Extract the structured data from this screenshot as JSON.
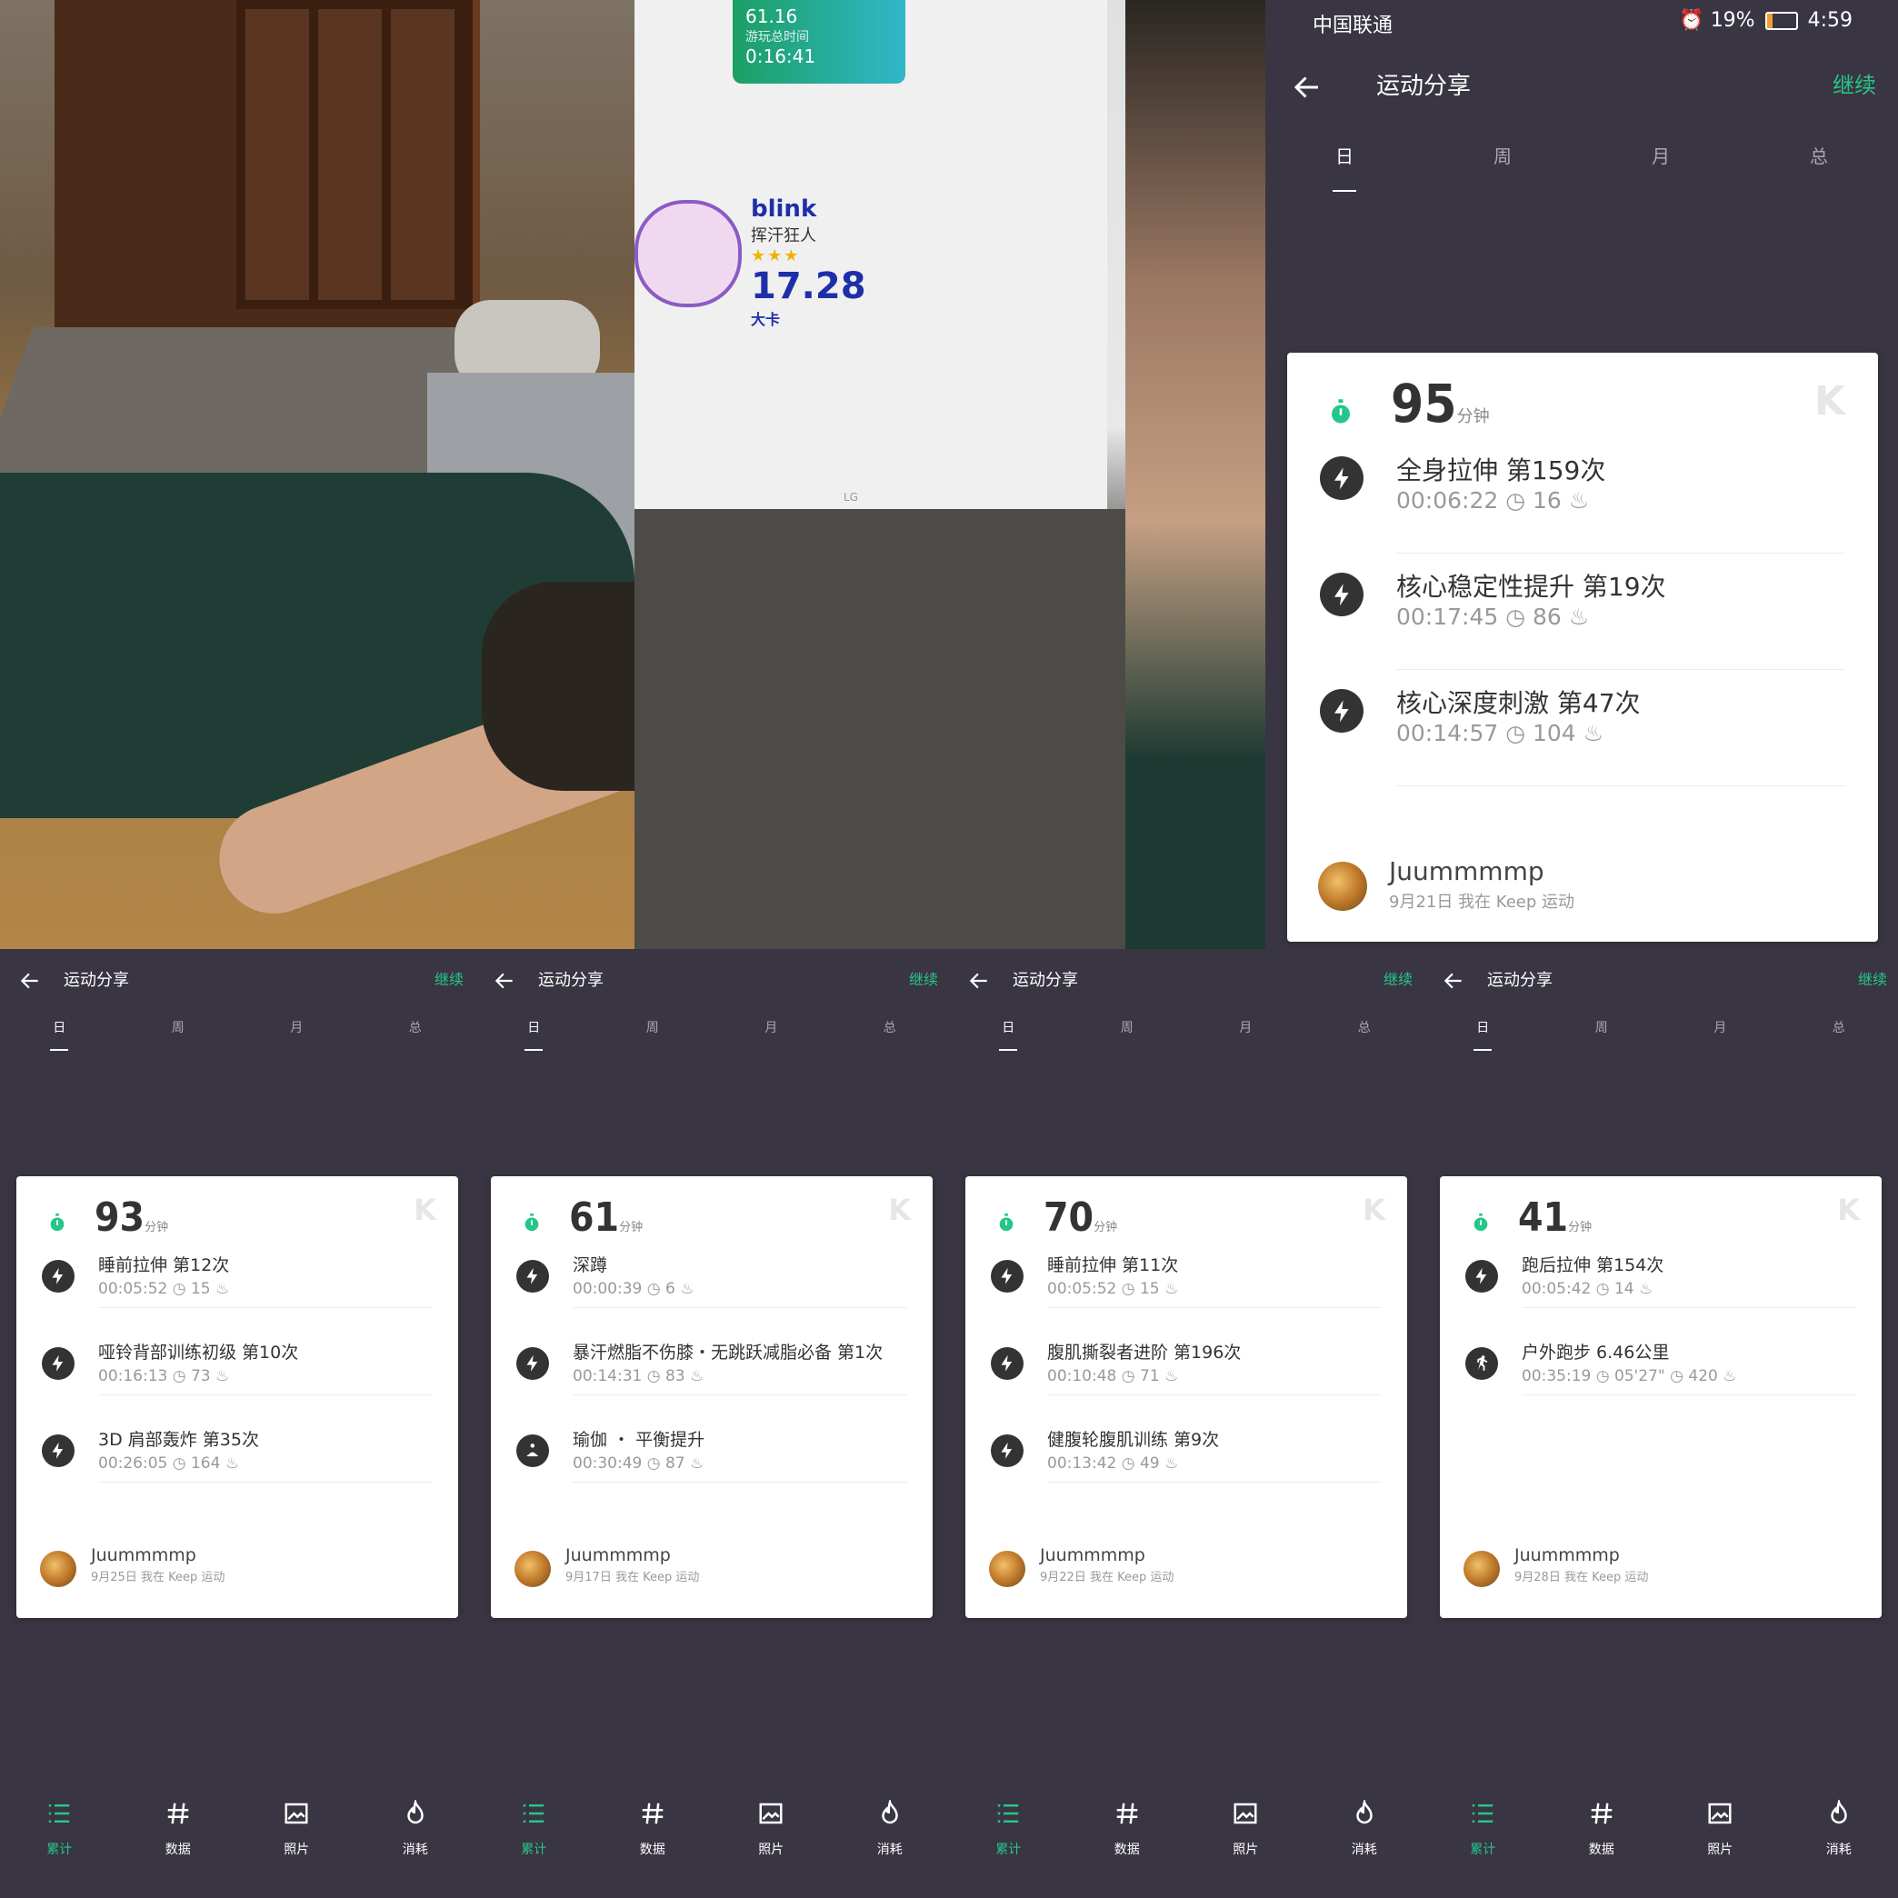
{
  "colors": {
    "background": "#3a3542",
    "accent": "#24c789",
    "card": "#ffffff",
    "icon": "#333333"
  },
  "photos": {
    "monitor": {
      "game_card_value": "61.16",
      "game_card_label": "游玩总时间",
      "game_card_time": "0:16:41",
      "blink_name": "blink",
      "blink_title": "挥汗狂人",
      "blink_stars": "★★★",
      "blink_value": "17.28",
      "blink_unit": "大卡",
      "brand": "LG"
    }
  },
  "status_bar": {
    "carrier": "中国联通",
    "battery": "19%",
    "battery_level": 0.19,
    "time": "4:59"
  },
  "screens": [
    {
      "title": "运动分享",
      "continue": "继续",
      "tabs": [
        "日",
        "周",
        "月",
        "总"
      ],
      "active_tab": 0,
      "total": "95",
      "unit": "分钟",
      "items": [
        {
          "icon": "bolt-icon",
          "name": "全身拉伸 第159次",
          "meta": "00:06:22 ◷   16 ♨"
        },
        {
          "icon": "bolt-icon",
          "name": "核心稳定性提升 第19次",
          "meta": "00:17:45 ◷   86 ♨"
        },
        {
          "icon": "bolt-icon",
          "name": "核心深度刺激 第47次",
          "meta": "00:14:57 ◷   104 ♨"
        }
      ],
      "user": {
        "name": "Juummmmp",
        "date": "9月21日 我在 Keep 运动"
      }
    },
    {
      "title": "运动分享",
      "continue": "继续",
      "tabs": [
        "日",
        "周",
        "月",
        "总"
      ],
      "active_tab": 0,
      "total": "93",
      "unit": "分钟",
      "items": [
        {
          "icon": "bolt-icon",
          "name": "睡前拉伸 第12次",
          "meta": "00:05:52 ◷   15 ♨"
        },
        {
          "icon": "bolt-icon",
          "name": "哑铃背部训练初级 第10次",
          "meta": "00:16:13 ◷   73 ♨"
        },
        {
          "icon": "bolt-icon",
          "name": "3D 肩部轰炸 第35次",
          "meta": "00:26:05 ◷   164 ♨"
        }
      ],
      "user": {
        "name": "Juummmmp",
        "date": "9月25日 我在 Keep 运动"
      },
      "nav": [
        "累计",
        "数据",
        "照片",
        "消耗"
      ]
    },
    {
      "title": "运动分享",
      "continue": "继续",
      "tabs": [
        "日",
        "周",
        "月",
        "总"
      ],
      "active_tab": 0,
      "total": "61",
      "unit": "分钟",
      "items": [
        {
          "icon": "bolt-icon",
          "name": "深蹲",
          "meta": "00:00:39 ◷   6 ♨"
        },
        {
          "icon": "bolt-icon",
          "name": "暴汗燃脂不伤膝・无跳跃减脂必备 第1次",
          "meta": "00:14:31 ◷   83 ♨"
        },
        {
          "icon": "yoga-icon",
          "name": "瑜伽 ・ 平衡提升",
          "meta": "00:30:49 ◷   87 ♨"
        }
      ],
      "user": {
        "name": "Juummmmp",
        "date": "9月17日 我在 Keep 运动"
      },
      "nav": [
        "累计",
        "数据",
        "照片",
        "消耗"
      ]
    },
    {
      "title": "运动分享",
      "continue": "继续",
      "tabs": [
        "日",
        "周",
        "月",
        "总"
      ],
      "active_tab": 0,
      "total": "70",
      "unit": "分钟",
      "items": [
        {
          "icon": "bolt-icon",
          "name": "睡前拉伸 第11次",
          "meta": "00:05:52 ◷   15 ♨"
        },
        {
          "icon": "bolt-icon",
          "name": "腹肌撕裂者进阶 第196次",
          "meta": "00:10:48 ◷   71 ♨"
        },
        {
          "icon": "bolt-icon",
          "name": "健腹轮腹肌训练 第9次",
          "meta": "00:13:42 ◷   49 ♨"
        }
      ],
      "user": {
        "name": "Juummmmp",
        "date": "9月22日 我在 Keep 运动"
      },
      "nav": [
        "累计",
        "数据",
        "照片",
        "消耗"
      ]
    },
    {
      "title": "运动分享",
      "continue": "继续",
      "tabs": [
        "日",
        "周",
        "月",
        "总"
      ],
      "active_tab": 0,
      "total": "41",
      "unit": "分钟",
      "items": [
        {
          "icon": "bolt-icon",
          "name": "跑后拉伸 第154次",
          "meta": "00:05:42 ◷   14 ♨"
        },
        {
          "icon": "running-icon",
          "name": "户外跑步 6.46公里",
          "meta": "00:35:19 ◷   05'27\" ◷   420 ♨"
        }
      ],
      "user": {
        "name": "Juummmmp",
        "date": "9月28日 我在 Keep 运动"
      },
      "nav": [
        "累计",
        "数据",
        "照片",
        "消耗"
      ]
    }
  ]
}
